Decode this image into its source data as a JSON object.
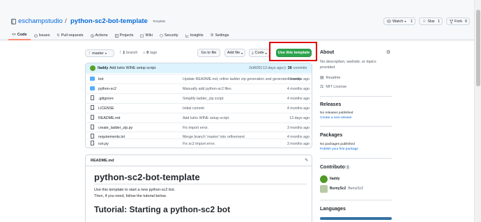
{
  "repo": {
    "owner": "eschampstudio",
    "sep": "/",
    "name": "python-sc2-bot-template",
    "badge": "Template",
    "watch_label": "Watch",
    "watch_count": "1",
    "star_label": "Star",
    "star_count": "1",
    "fork_label": "Fork",
    "fork_count": "0"
  },
  "tabs": [
    {
      "label": "Code",
      "icon": "code-icon",
      "selected": true
    },
    {
      "label": "Issues",
      "icon": "issue-icon"
    },
    {
      "label": "Pull requests",
      "icon": "pull-request-icon"
    },
    {
      "label": "Actions",
      "icon": "actions-icon"
    },
    {
      "label": "Projects",
      "icon": "projects-icon"
    },
    {
      "label": "Wiki",
      "icon": "wiki-icon"
    },
    {
      "label": "Security",
      "icon": "shield-icon"
    },
    {
      "label": "Insights",
      "icon": "graph-icon"
    },
    {
      "label": "Settings",
      "icon": "gear-icon"
    }
  ],
  "toolbar": {
    "branch": "master",
    "branches_count": "1",
    "branches_label": "branch",
    "tags_count": "0",
    "tags_label": "tags",
    "goto_file": "Go to file",
    "add_file": "Add file",
    "code": "Code",
    "use_template": "Use this template"
  },
  "commit": {
    "author": "lladdy",
    "message": "Add lutris WINE setup script.",
    "hash": "2e98391",
    "time": "13 days ago",
    "commits_count": "38",
    "commits_label": "commits"
  },
  "files": [
    {
      "type": "dir",
      "name": "bot",
      "message": "Update README.md, refine ladder zip generation and generate cleanup.",
      "time": "4 months ago"
    },
    {
      "type": "dir",
      "name": "python-sc2",
      "message": "Manually add python-sc2 files",
      "time": "4 months ago"
    },
    {
      "type": "file",
      "name": ".gitignore",
      "message": "Simplify ladder_zip script",
      "time": "4 months ago"
    },
    {
      "type": "file",
      "name": "LICENSE",
      "message": "Initial commit",
      "time": "4 months ago"
    },
    {
      "type": "file",
      "name": "README.md",
      "message": "Add lutris WINE setup script.",
      "time": "13 days ago"
    },
    {
      "type": "file",
      "name": "create_ladder_zip.py",
      "message": "Fix import error.",
      "time": "3 months ago"
    },
    {
      "type": "file",
      "name": "requirements.txt",
      "message": "Merge branch 'master' into refinement",
      "time": "4 months ago"
    },
    {
      "type": "file",
      "name": "run.py",
      "message": "Fix sc2 import error.",
      "time": "3 months ago"
    }
  ],
  "readme": {
    "filename": "README.md",
    "h1": "python-sc2-bot-template",
    "p1": "Use this template to start a new python-sc2 bot.",
    "p2": "Then, if you need, follow the tutorial below.",
    "h2": "Tutorial: Starting a python-sc2 bot"
  },
  "sidebar": {
    "about_title": "About",
    "description": "No description, website, or topics provided.",
    "readme_label": "Readme",
    "license_label": "MIT License",
    "releases_title": "Releases",
    "releases_text": "No releases published",
    "releases_link": "Create a new release",
    "packages_title": "Packages",
    "packages_text": "No packages published",
    "packages_link": "Publish your first package",
    "contributors_title": "Contributors",
    "contributors_count": "2",
    "contributors": [
      {
        "login": "lladdy",
        "name": ""
      },
      {
        "login": "BurnySc2",
        "name": "BurnySc2"
      }
    ],
    "languages_title": "Languages"
  },
  "colors": {
    "green": "#2da44e",
    "highlight_red": "#e00000",
    "link": "#0969da",
    "tab_underline": "#fd8c73"
  }
}
